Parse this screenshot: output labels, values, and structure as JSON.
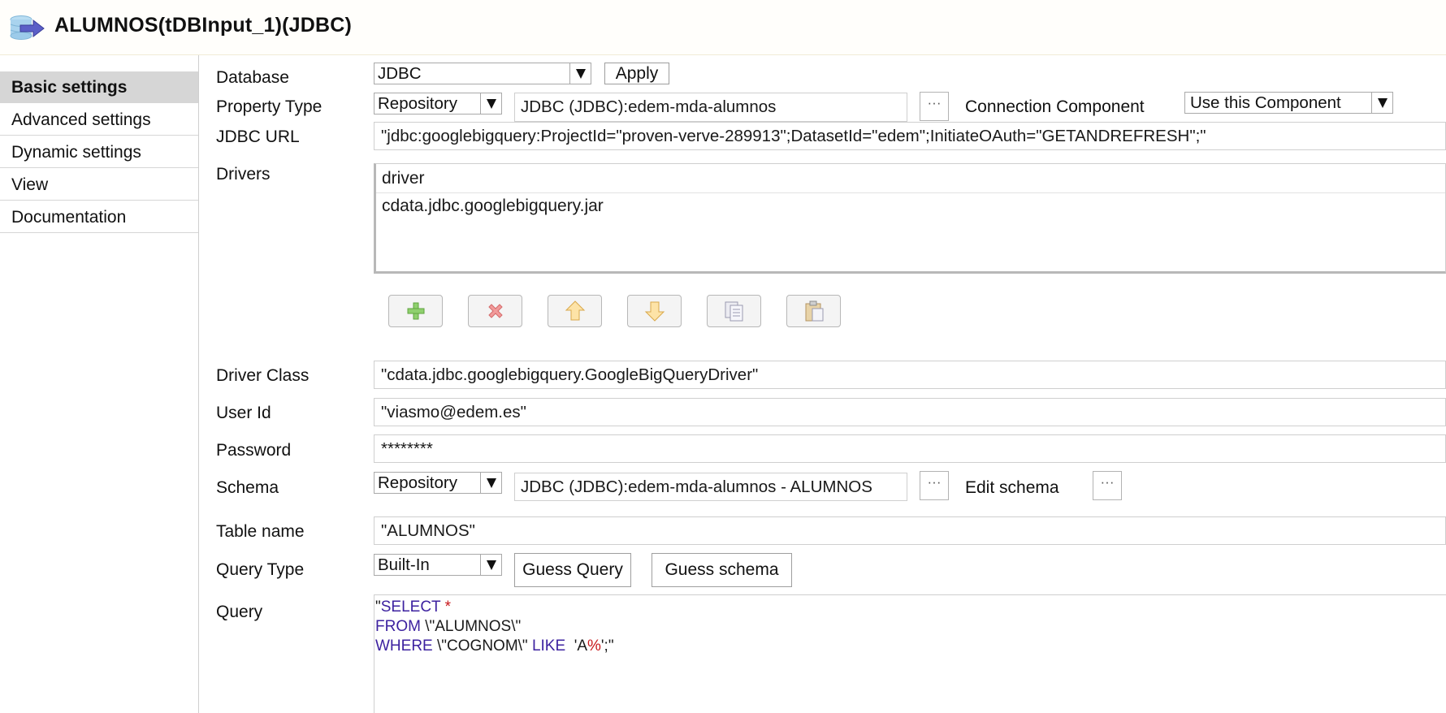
{
  "title": "ALUMNOS(tDBInput_1)(JDBC)",
  "sidebar": {
    "items": [
      {
        "label": "Basic settings",
        "active": true
      },
      {
        "label": "Advanced settings"
      },
      {
        "label": "Dynamic settings"
      },
      {
        "label": "View"
      },
      {
        "label": "Documentation"
      }
    ]
  },
  "form": {
    "database": {
      "label": "Database",
      "value": "JDBC",
      "apply_label": "Apply"
    },
    "property_type": {
      "label": "Property Type",
      "value": "Repository",
      "repository_value": "JDBC (JDBC):edem-mda-alumnos",
      "browse_label": "···",
      "connection_component_label": "Connection Component",
      "connection_component_value": "Use this Component"
    },
    "jdbc_url": {
      "label": "JDBC URL",
      "value": "\"jdbc:googlebigquery:ProjectId=\"proven-verve-289913\";DatasetId=\"edem\";InitiateOAuth=\"GETANDREFRESH\";\""
    },
    "drivers": {
      "label": "Drivers",
      "column_header": "driver",
      "rows": [
        "cdata.jdbc.googlebigquery.jar"
      ]
    },
    "toolbar": [
      "add-icon",
      "remove-icon",
      "move-up-icon",
      "move-down-icon",
      "copy-icon",
      "paste-icon"
    ],
    "driver_class": {
      "label": "Driver Class",
      "value": "\"cdata.jdbc.googlebigquery.GoogleBigQueryDriver\""
    },
    "user_id": {
      "label": "User Id",
      "value": "\"viasmo@edem.es\""
    },
    "password": {
      "label": "Password",
      "value": "********"
    },
    "schema": {
      "label": "Schema",
      "value": "Repository",
      "repository_value": "JDBC (JDBC):edem-mda-alumnos - ALUMNOS",
      "browse_label": "···",
      "edit_schema_label": "Edit schema",
      "edit_schema_button": "···"
    },
    "table_name": {
      "label": "Table name",
      "value": "\"ALUMNOS\""
    },
    "query_type": {
      "label": "Query Type",
      "value": "Built-In",
      "guess_query_label": "Guess Query",
      "guess_schema_label": "Guess schema"
    },
    "query": {
      "label": "Query",
      "line1": {
        "p0": "\"",
        "kw": "SELECT",
        "sp": " ",
        "star": "*"
      },
      "line2": {
        "kw": "FROM",
        "rest": " \\\"ALUMNOS\\\""
      },
      "line3": {
        "kw": "WHERE",
        "mid": " \\\"COGNOM\\\" ",
        "kw2": "LIKE",
        "sq": "  'A",
        "pct": "%",
        "tail": "';\""
      }
    }
  },
  "colors": {
    "sidebar_active_bg": "#d6d6d6",
    "keyword": "#3d22a0",
    "operator": "#c8171b"
  }
}
